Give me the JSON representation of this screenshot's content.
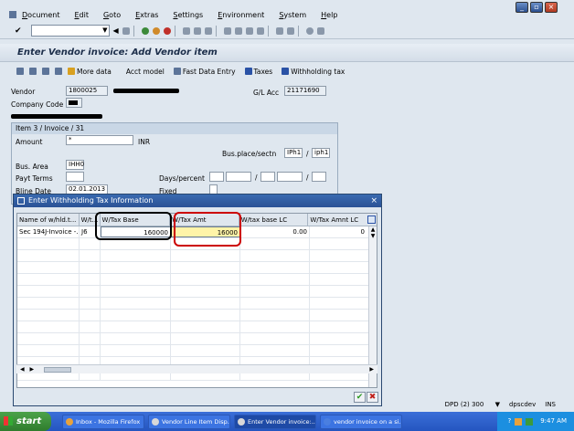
{
  "menu": [
    "Document",
    "Edit",
    "Goto",
    "Extras",
    "Settings",
    "Environment",
    "System",
    "Help"
  ],
  "window_title": "Enter Vendor invoice: Add Vendor item",
  "app_toolbar": {
    "more_data": "More data",
    "acct_model": "Acct model",
    "fast_data_entry": "Fast Data Entry",
    "taxes": "Taxes",
    "withholding_tax": "Withholding tax"
  },
  "form": {
    "vendor_label": "Vendor",
    "vendor_value": "1800025",
    "gl_acc_label": "G/L Acc",
    "gl_acc_value": "21171690",
    "company_code_label": "Company Code"
  },
  "item": {
    "title": "Item 3 / Invoice / 31",
    "amount_label": "Amount",
    "amount_value": "*",
    "currency": "INR",
    "bus_place_label": "Bus.place/sectn",
    "bus_place_value1": "IPh1",
    "bus_place_value2": "iph1",
    "bus_area_label": "Bus. Area",
    "bus_area_value": "IHH0",
    "payt_terms_label": "Payt Terms",
    "days_percent_label": "Days/percent",
    "bline_date_label": "Bline Date",
    "bline_date_value": "02.01.2013",
    "fixed_label": "Fixed"
  },
  "dialog": {
    "title": "Enter Withholding Tax Information",
    "columns": [
      "Name of w/hld.t...",
      "W/t...",
      "W/Tax Base",
      "W/Tax Amt",
      "W/tax base LC",
      "W/Tax Amnt LC"
    ],
    "row": {
      "name": "Sec 194J-Invoice -...",
      "code": "J6",
      "base": "160000",
      "amt": "16000",
      "base_lc": "0.00",
      "amt_lc": "0"
    }
  },
  "status": {
    "system": "DPD (2) 300",
    "server": "dpscdev",
    "mode": "INS"
  },
  "taskbar": {
    "start": "start",
    "tasks": [
      "Inbox - Mozilla Firefox",
      "Vendor Line Item Disp...",
      "Enter Vendor invoice:...",
      "vendor invoice on a si..."
    ],
    "time": "9:47 AM"
  },
  "colors": {
    "accent": "#2a5296",
    "highlight": "#fff4a8",
    "annotation": "#cc0000"
  }
}
